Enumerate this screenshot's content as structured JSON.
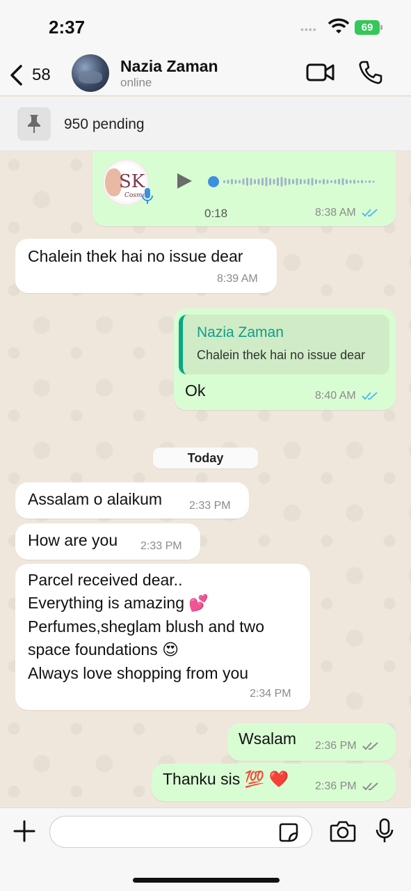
{
  "status": {
    "time": "2:37",
    "battery": "69"
  },
  "header": {
    "back_count": "58",
    "contact_name": "Nazia Zaman",
    "presence": "online"
  },
  "pinned": {
    "label": "950 pending"
  },
  "messages": [
    {
      "type": "voice",
      "direction": "out",
      "duration": "0:18",
      "time": "8:38 AM",
      "status": "read"
    },
    {
      "type": "text",
      "direction": "in",
      "text": "Chalein thek hai no issue dear",
      "time": "8:39 AM"
    },
    {
      "type": "reply",
      "direction": "out",
      "quote_name": "Nazia Zaman",
      "quote_text": "Chalein thek hai no issue dear",
      "text": "Ok",
      "time": "8:40 AM",
      "status": "read"
    },
    {
      "type": "date",
      "label": "Today"
    },
    {
      "type": "text",
      "direction": "in",
      "text": "Assalam o alaikum",
      "time": "2:33 PM"
    },
    {
      "type": "text",
      "direction": "in",
      "text": "How are you",
      "time": "2:33 PM"
    },
    {
      "type": "multiline",
      "direction": "in",
      "lines": [
        "Parcel received dear..",
        "Everything is amazing 💕",
        "Perfumes,sheglam blush and two",
        "space foundations 😍",
        "Always love shopping from you"
      ],
      "time": "2:34 PM"
    },
    {
      "type": "text",
      "direction": "out",
      "text": "Wsalam",
      "time": "2:36 PM",
      "status": "delivered"
    },
    {
      "type": "text",
      "direction": "out",
      "text": "Thanku sis 💯 ❤️",
      "time": "2:36 PM",
      "status": "delivered"
    }
  ],
  "icons": [
    "back-chevron-icon",
    "video-call-icon",
    "phone-icon",
    "pin-icon",
    "play-icon",
    "mic-icon",
    "plus-icon",
    "sticker-icon",
    "camera-icon",
    "microphone-icon"
  ],
  "colors": {
    "accent": "#53bdeb",
    "outgoing_bubble": "#d9fdd3",
    "incoming_bubble": "#ffffff",
    "quote_name": "#119c8a"
  }
}
